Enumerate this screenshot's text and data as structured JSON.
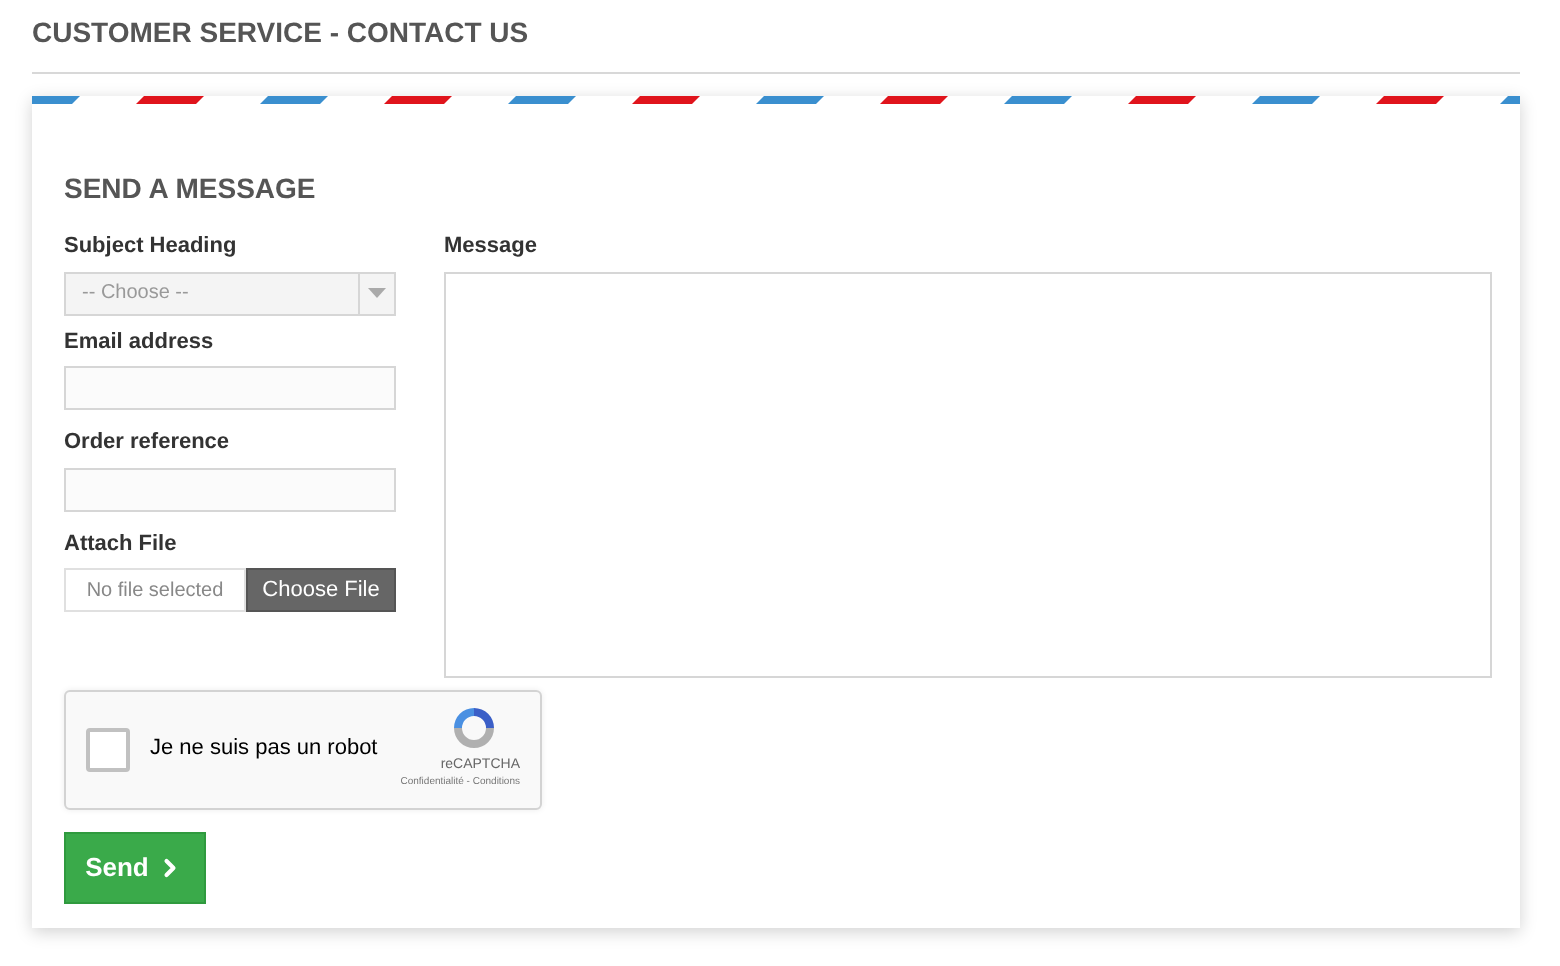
{
  "page_title": "CUSTOMER SERVICE - CONTACT US",
  "form": {
    "title": "SEND A MESSAGE",
    "subject": {
      "label": "Subject Heading",
      "value": "-- Choose --"
    },
    "email": {
      "label": "Email address"
    },
    "order": {
      "label": "Order reference"
    },
    "attach": {
      "label": "Attach File",
      "status": "No file selected",
      "button": "Choose File"
    },
    "message": {
      "label": "Message"
    },
    "captcha": {
      "label": "Je ne suis pas un robot",
      "checked": false,
      "brand": "reCAPTCHA",
      "links": "Confidentialité - Conditions"
    },
    "send": "Send"
  }
}
